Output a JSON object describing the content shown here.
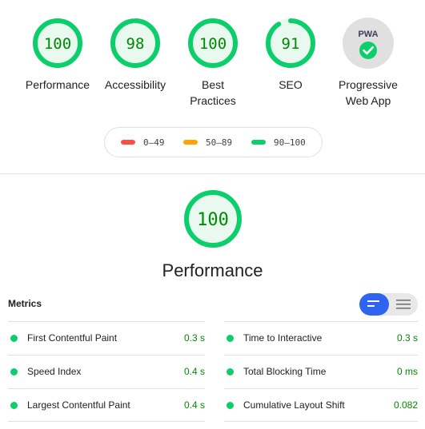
{
  "colors": {
    "pass": "#0cce6b",
    "pass_text": "#008a00",
    "average": "#ffa400",
    "fail": "#ff4e42",
    "accent": "#2d64f0",
    "pwa_bg": "#e0e0e0"
  },
  "categories": [
    {
      "score": "100",
      "score_value": 100,
      "label": "Performance"
    },
    {
      "score": "98",
      "score_value": 98,
      "label": "Accessibility"
    },
    {
      "score": "100",
      "score_value": 100,
      "label": "Best Practices"
    },
    {
      "score": "91",
      "score_value": 91,
      "label": "SEO"
    },
    {
      "badge_text": "PWA",
      "label": "Progressive Web App",
      "icon": "pwa-check-icon"
    }
  ],
  "legend": [
    {
      "range": "0–49",
      "color": "#ff4e42"
    },
    {
      "range": "50–89",
      "color": "#ffa400"
    },
    {
      "range": "90–100",
      "color": "#0cce6b"
    }
  ],
  "performance": {
    "score": "100",
    "score_value": 100,
    "title": "Performance"
  },
  "metrics": {
    "heading": "Metrics",
    "view_toggle": {
      "active": "compact-view",
      "icons": [
        "compact-view-icon",
        "expanded-view-icon"
      ]
    },
    "left": [
      {
        "name": "First Contentful Paint",
        "value": "0.3 s"
      },
      {
        "name": "Speed Index",
        "value": "0.4 s"
      },
      {
        "name": "Largest Contentful Paint",
        "value": "0.4 s"
      }
    ],
    "right": [
      {
        "name": "Time to Interactive",
        "value": "0.3 s"
      },
      {
        "name": "Total Blocking Time",
        "value": "0 ms"
      },
      {
        "name": "Cumulative Layout Shift",
        "value": "0.082"
      }
    ]
  }
}
